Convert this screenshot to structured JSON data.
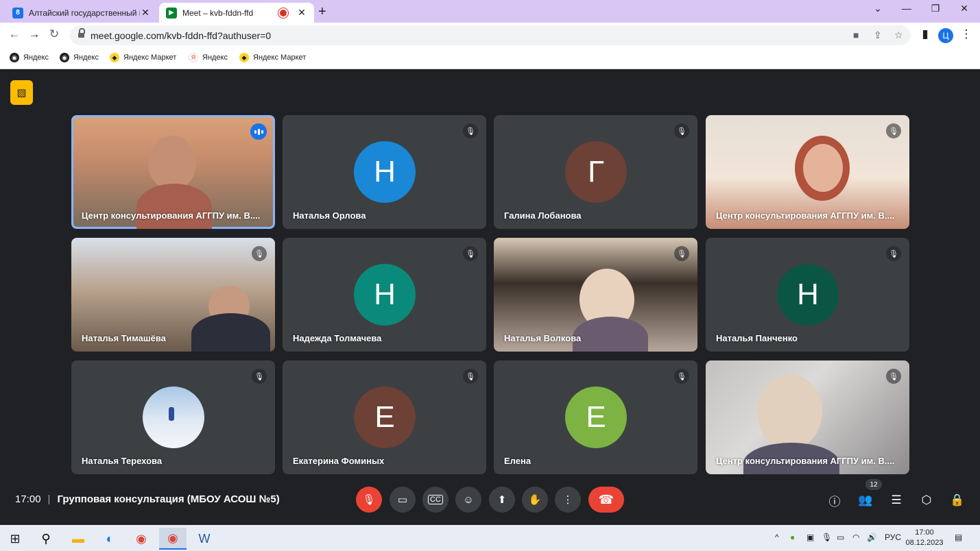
{
  "browser": {
    "tabs": [
      {
        "title": "Алтайский государственный гу",
        "favicon": "calendar-icon",
        "active": false
      },
      {
        "title": "Meet – kvb-fddn-ffd",
        "favicon": "meet-icon",
        "active": true
      }
    ],
    "url": "meet.google.com/kvb-fddn-ffd?authuser=0",
    "profile_initial": "Ц",
    "bookmarks": [
      {
        "label": "Яндекс",
        "icon": "globe-icon"
      },
      {
        "label": "Яндекс",
        "icon": "globe-icon"
      },
      {
        "label": "Яндекс Маркет",
        "icon": "market-icon"
      },
      {
        "label": "Яндекс",
        "icon": "yandex-icon"
      },
      {
        "label": "Яндекс Маркет",
        "icon": "market-icon"
      }
    ]
  },
  "meet": {
    "participants": [
      {
        "name": "Центр консультирования АГГПУ им. В....",
        "kind": "video",
        "speaking": true
      },
      {
        "name": "Наталья Орлова",
        "kind": "avatar",
        "initial": "Н",
        "color": "#1a88d6",
        "muted": true
      },
      {
        "name": "Галина Лобанова",
        "kind": "avatar",
        "initial": "Г",
        "color": "#6d4136",
        "muted": true
      },
      {
        "name": "Центр консультирования АГГПУ им. В....",
        "kind": "video",
        "muted": true
      },
      {
        "name": "Наталья Тимашёва",
        "kind": "video",
        "muted": true
      },
      {
        "name": "Надежда Толмачева",
        "kind": "avatar",
        "initial": "Н",
        "color": "#0a8a7b",
        "muted": true
      },
      {
        "name": "Наталья Волкова",
        "kind": "video",
        "muted": true
      },
      {
        "name": "Наталья Панченко",
        "kind": "avatar",
        "initial": "Н",
        "color": "#0b5545",
        "muted": true
      },
      {
        "name": "Наталья Терехова",
        "kind": "photo",
        "muted": true
      },
      {
        "name": "Екатерина Фоминых",
        "kind": "avatar",
        "initial": "Е",
        "color": "#6d4136",
        "muted": true
      },
      {
        "name": "Елена",
        "kind": "avatar",
        "initial": "Е",
        "color": "#7cb342",
        "muted": true
      },
      {
        "name": "Центр консультирования АГГПУ им. В....",
        "kind": "video",
        "muted": true
      }
    ],
    "time": "17:00",
    "separator": "|",
    "meeting_title": "Групповая консультация (МБОУ АСОШ №5)",
    "participant_count": "12"
  },
  "taskbar": {
    "lang": "РУС",
    "clock_time": "17:00",
    "clock_date": "08.12.2023"
  }
}
